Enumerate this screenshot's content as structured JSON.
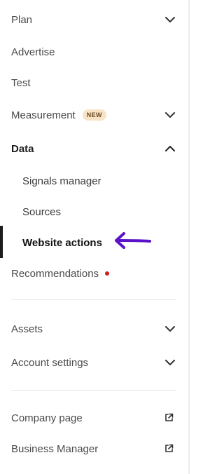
{
  "sidebar": {
    "plan": {
      "label": "Plan",
      "icon": "chevron-down-icon"
    },
    "advertise": {
      "label": "Advertise"
    },
    "test": {
      "label": "Test"
    },
    "measurement": {
      "label": "Measurement",
      "badge": "NEW",
      "icon": "chevron-down-icon"
    },
    "data": {
      "label": "Data",
      "icon": "chevron-up-icon",
      "children": [
        {
          "label": "Signals manager"
        },
        {
          "label": "Sources"
        },
        {
          "label": "Website actions",
          "active": true
        }
      ]
    },
    "recommendations": {
      "label": "Recommendations",
      "indicator_color": "#cc1e1e"
    },
    "assets": {
      "label": "Assets",
      "icon": "chevron-down-icon"
    },
    "account_settings": {
      "label": "Account settings",
      "icon": "chevron-down-icon"
    },
    "company_page": {
      "label": "Company page",
      "icon": "external-link-icon"
    },
    "business_manager": {
      "label": "Business Manager",
      "icon": "external-link-icon"
    }
  },
  "annotation": {
    "type": "arrow",
    "color": "#5b12c8"
  },
  "colors": {
    "active_bar": "#1c1c1c",
    "badge_bg": "#f7e3c6",
    "divider": "#e6e6e6"
  }
}
